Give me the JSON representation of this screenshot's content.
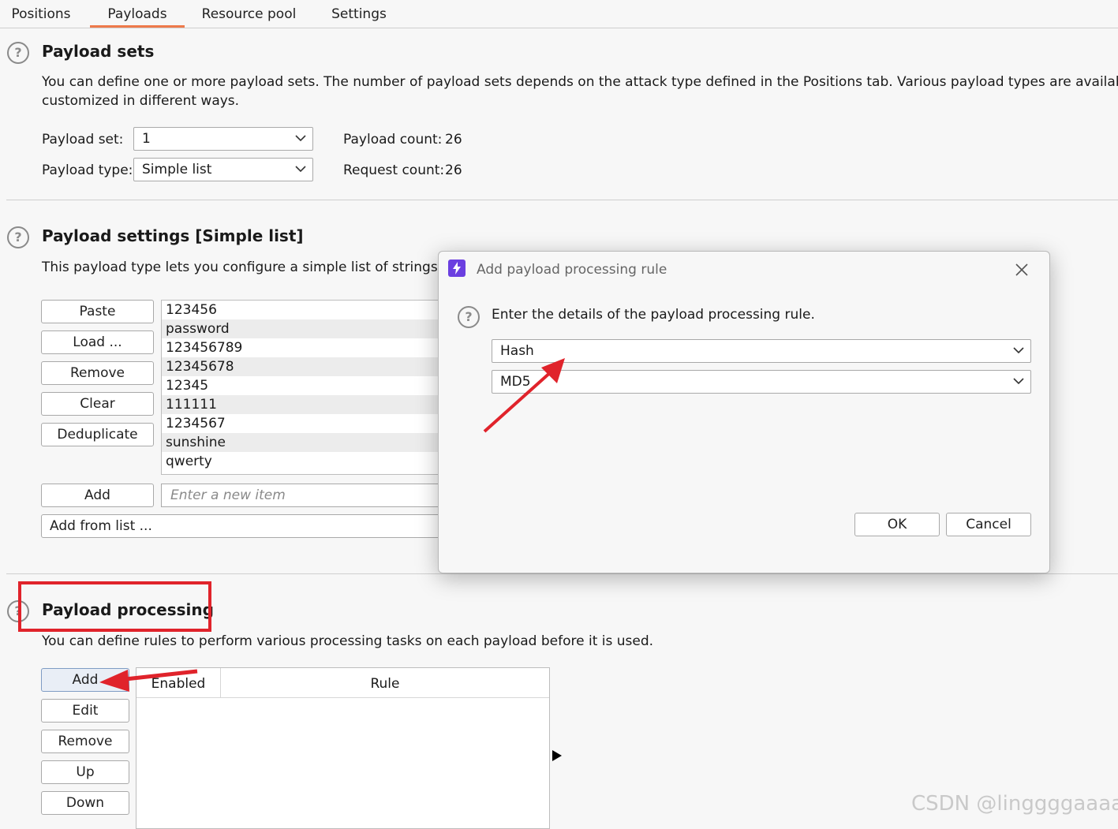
{
  "tabs": [
    "Positions",
    "Payloads",
    "Resource pool",
    "Settings"
  ],
  "active_tab": "Payloads",
  "payload_sets": {
    "title": "Payload sets",
    "desc_line1": "You can define one or more payload sets. The number of payload sets depends on the attack type defined in the Positions tab. Various payload types are available for e",
    "desc_line2": "customized in different ways.",
    "set_label": "Payload set:",
    "set_value": "1",
    "type_label": "Payload type:",
    "type_value": "Simple list",
    "payload_count_label": "Payload count:",
    "payload_count": "26",
    "request_count_label": "Request count:",
    "request_count": "26"
  },
  "payload_settings": {
    "title": "Payload settings [Simple list]",
    "desc": "This payload type lets you configure a simple list of strings tha",
    "buttons": [
      "Paste",
      "Load ...",
      "Remove",
      "Clear",
      "Deduplicate"
    ],
    "items": [
      "123456",
      "password",
      "123456789",
      "12345678",
      "12345",
      "111111",
      "1234567",
      "sunshine",
      "qwerty"
    ],
    "add_label": "Add",
    "new_item_placeholder": "Enter a new item",
    "add_from_list": "Add from list ..."
  },
  "payload_processing": {
    "title": "Payload processing",
    "desc": "You can define rules to perform various processing tasks on each payload before it is used.",
    "buttons": [
      "Add",
      "Edit",
      "Remove",
      "Up",
      "Down"
    ],
    "columns": [
      "Enabled",
      "Rule"
    ]
  },
  "dialog": {
    "title": "Add payload processing rule",
    "prompt": "Enter the details of the payload processing rule.",
    "rule_type": "Hash",
    "algorithm": "MD5",
    "ok": "OK",
    "cancel": "Cancel"
  },
  "watermark": "CSDN @linggggaaaa",
  "colors": {
    "tab_underline": "#ee7a4b",
    "annotation_red": "#e0232b",
    "dialog_icon": "#6b3fe0"
  }
}
